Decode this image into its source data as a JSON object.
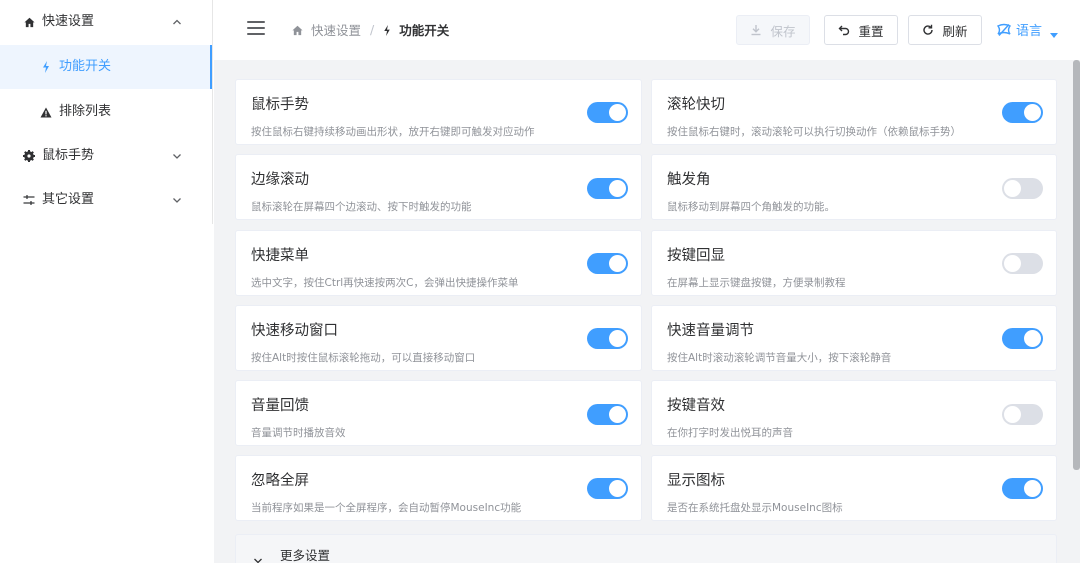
{
  "sidebar": {
    "items": [
      {
        "label": "快速设置",
        "icon": "home-icon",
        "expanded": true
      },
      {
        "label": "功能开关",
        "icon": "bolt-icon",
        "active": true
      },
      {
        "label": "排除列表",
        "icon": "warning-icon"
      },
      {
        "label": "鼠标手势",
        "icon": "gear-icon",
        "expanded": false
      },
      {
        "label": "其它设置",
        "icon": "sliders-icon",
        "expanded": false
      }
    ]
  },
  "header": {
    "breadcrumb": {
      "parent": "快速设置",
      "separator": "/",
      "current": "功能开关"
    },
    "buttons": {
      "save": "保存",
      "reset": "重置",
      "refresh": "刷新"
    },
    "language": "语言"
  },
  "features": [
    {
      "title": "鼠标手势",
      "desc": "按住鼠标右键持续移动画出形状，放开右键即可触发对应动作",
      "enabled": true
    },
    {
      "title": "滚轮快切",
      "desc": "按住鼠标右键时，滚动滚轮可以执行切换动作（依赖鼠标手势）",
      "enabled": true
    },
    {
      "title": "边缘滚动",
      "desc": "鼠标滚轮在屏幕四个边滚动、按下时触发的功能",
      "enabled": true
    },
    {
      "title": "触发角",
      "desc": "鼠标移动到屏幕四个角触发的功能。",
      "enabled": false
    },
    {
      "title": "快捷菜单",
      "desc": "选中文字，按住Ctrl再快速按两次C，会弹出快捷操作菜单",
      "enabled": true
    },
    {
      "title": "按键回显",
      "desc": "在屏幕上显示键盘按键，方便录制教程",
      "enabled": false
    },
    {
      "title": "快速移动窗口",
      "desc": "按住Alt时按住鼠标滚轮拖动，可以直接移动窗口",
      "enabled": true
    },
    {
      "title": "快速音量调节",
      "desc": "按住Alt时滚动滚轮调节音量大小，按下滚轮静音",
      "enabled": true
    },
    {
      "title": "音量回馈",
      "desc": "音量调节时播放音效",
      "enabled": true
    },
    {
      "title": "按键音效",
      "desc": "在你打字时发出悦耳的声音",
      "enabled": false
    },
    {
      "title": "忽略全屏",
      "desc": "当前程序如果是一个全屏程序，会自动暂停MouseInc功能",
      "enabled": true
    },
    {
      "title": "显示图标",
      "desc": "是否在系统托盘处显示MouseInc图标",
      "enabled": true
    }
  ],
  "more_settings": "更多设置",
  "colors": {
    "accent": "#409eff",
    "switch_off": "#dcdfe6",
    "background": "#f2f3f5"
  }
}
